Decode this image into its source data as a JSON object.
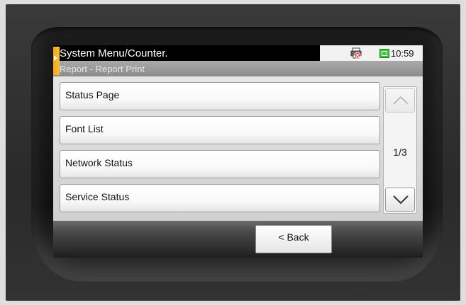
{
  "header": {
    "title": "System Menu/Counter.",
    "clock": "10:59",
    "icons": [
      "printer-error-icon",
      "toner-status-icon"
    ]
  },
  "breadcrumb": "Report - Report Print",
  "list": {
    "items": [
      {
        "label": "Status Page"
      },
      {
        "label": "Font List"
      },
      {
        "label": "Network Status"
      },
      {
        "label": "Service Status"
      }
    ]
  },
  "pager": {
    "indicator": "1/3",
    "up_icon": "chevron-up-icon",
    "down_icon": "chevron-down-icon"
  },
  "footer": {
    "back_label": "< Back"
  },
  "colors": {
    "accent": "#f3a61c",
    "toner_ok": "#3ec43a",
    "error_red": "#e02020"
  }
}
